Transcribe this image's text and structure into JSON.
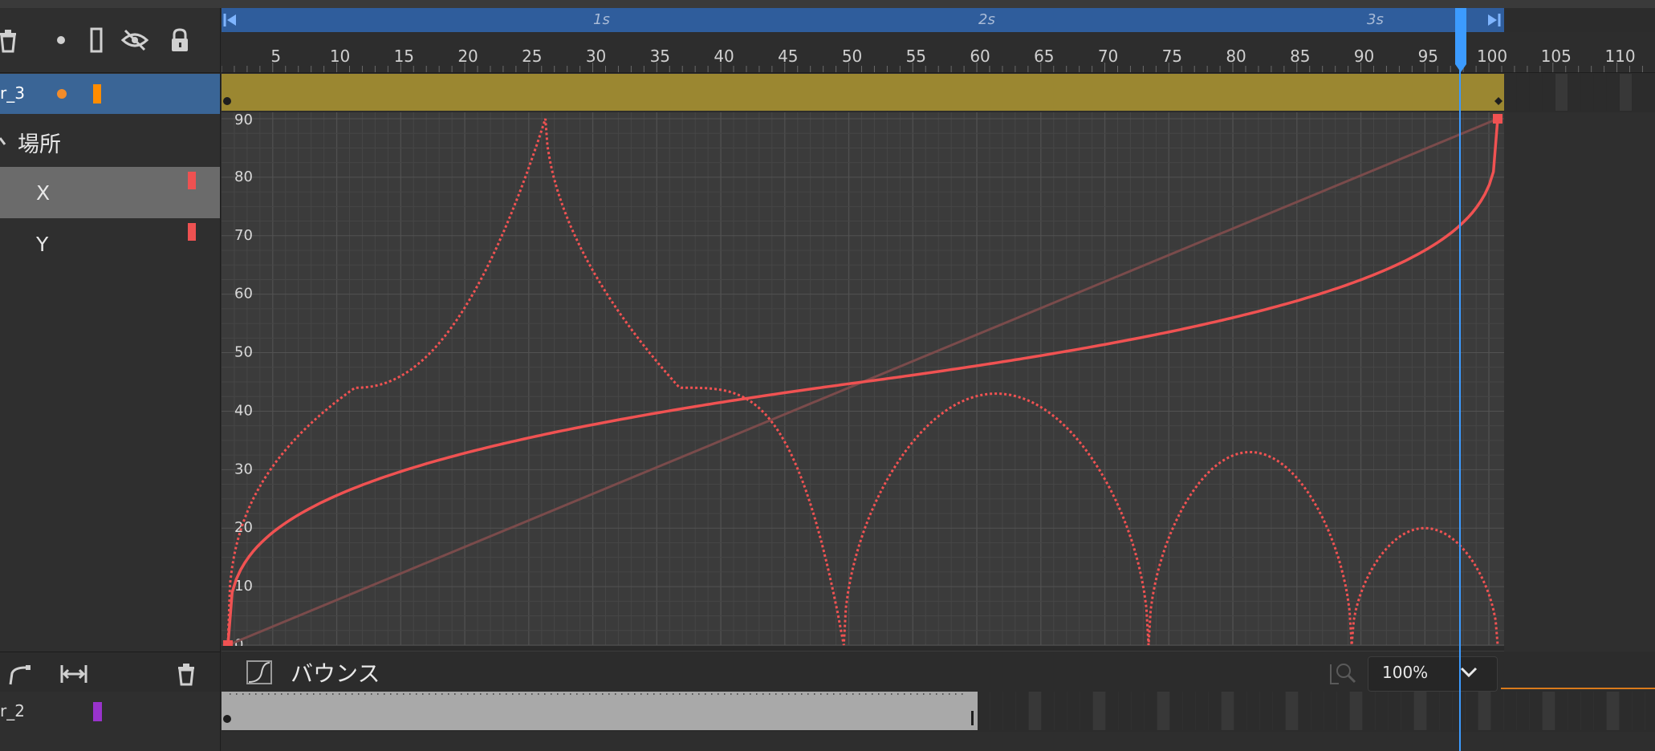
{
  "toolbar": {
    "icons": [
      "trash-icon",
      "dot-icon",
      "outline-icon",
      "eye-hidden-icon",
      "lock-icon"
    ]
  },
  "layers": {
    "layer3": {
      "name": "r_3",
      "dot_color": "#f28c2a",
      "swatch_color": "#ff8c00"
    },
    "group": {
      "name": "場所"
    },
    "properties": [
      {
        "name": "X",
        "marker_color": "#ee5151"
      },
      {
        "name": "Y",
        "marker_color": "#ee5151"
      }
    ],
    "layer2": {
      "name": "r_2",
      "swatch_color": "#9933cc"
    }
  },
  "timeline": {
    "seconds": [
      "1s",
      "2s",
      "3s"
    ],
    "ruler": [
      "5",
      "10",
      "15",
      "20",
      "25",
      "30",
      "35",
      "40",
      "45",
      "50",
      "55",
      "60",
      "65",
      "70",
      "75",
      "80",
      "85",
      "90",
      "95",
      "100",
      "105",
      "110"
    ],
    "playhead_frame": 97.5
  },
  "graph": {
    "y_ticks": [
      "90",
      "80",
      "70",
      "60",
      "50",
      "40",
      "30",
      "20",
      "10",
      "0"
    ],
    "curve_color": "#f05252",
    "ghost_color": "#7a4b4b"
  },
  "ease": {
    "label": "バウンス",
    "zoom_value": "100%"
  },
  "bottom_tools": {
    "icons": [
      "pen-icon",
      "fit-width-icon",
      "trash-icon"
    ]
  }
}
